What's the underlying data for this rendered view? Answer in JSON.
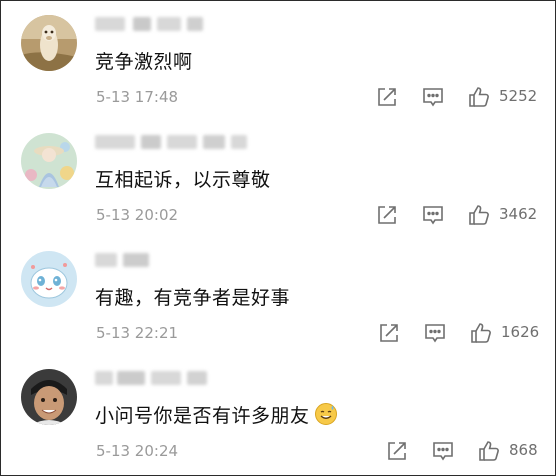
{
  "comments": [
    {
      "text": "竞争激烈啊",
      "time": "5-13 17:48",
      "likes": "5252"
    },
    {
      "text": "互相起诉，以示尊敬",
      "time": "5-13 20:02",
      "likes": "3462"
    },
    {
      "text": "有趣，有竞争者是好事",
      "time": "5-13 22:21",
      "likes": "1626"
    },
    {
      "text": "小问号你是否有许多朋友",
      "time": "5-13 20:24",
      "likes": "868"
    }
  ],
  "icons": {
    "repost": "share-edit-icon",
    "comment": "comment-bubble-icon",
    "like": "thumbs-up-icon",
    "emoji": "sweat-smile-emoji-icon"
  },
  "colors": {
    "text": "#111111",
    "meta": "#9a9a9a",
    "icon": "#6f6f6f",
    "border": "#2b2b2b"
  }
}
